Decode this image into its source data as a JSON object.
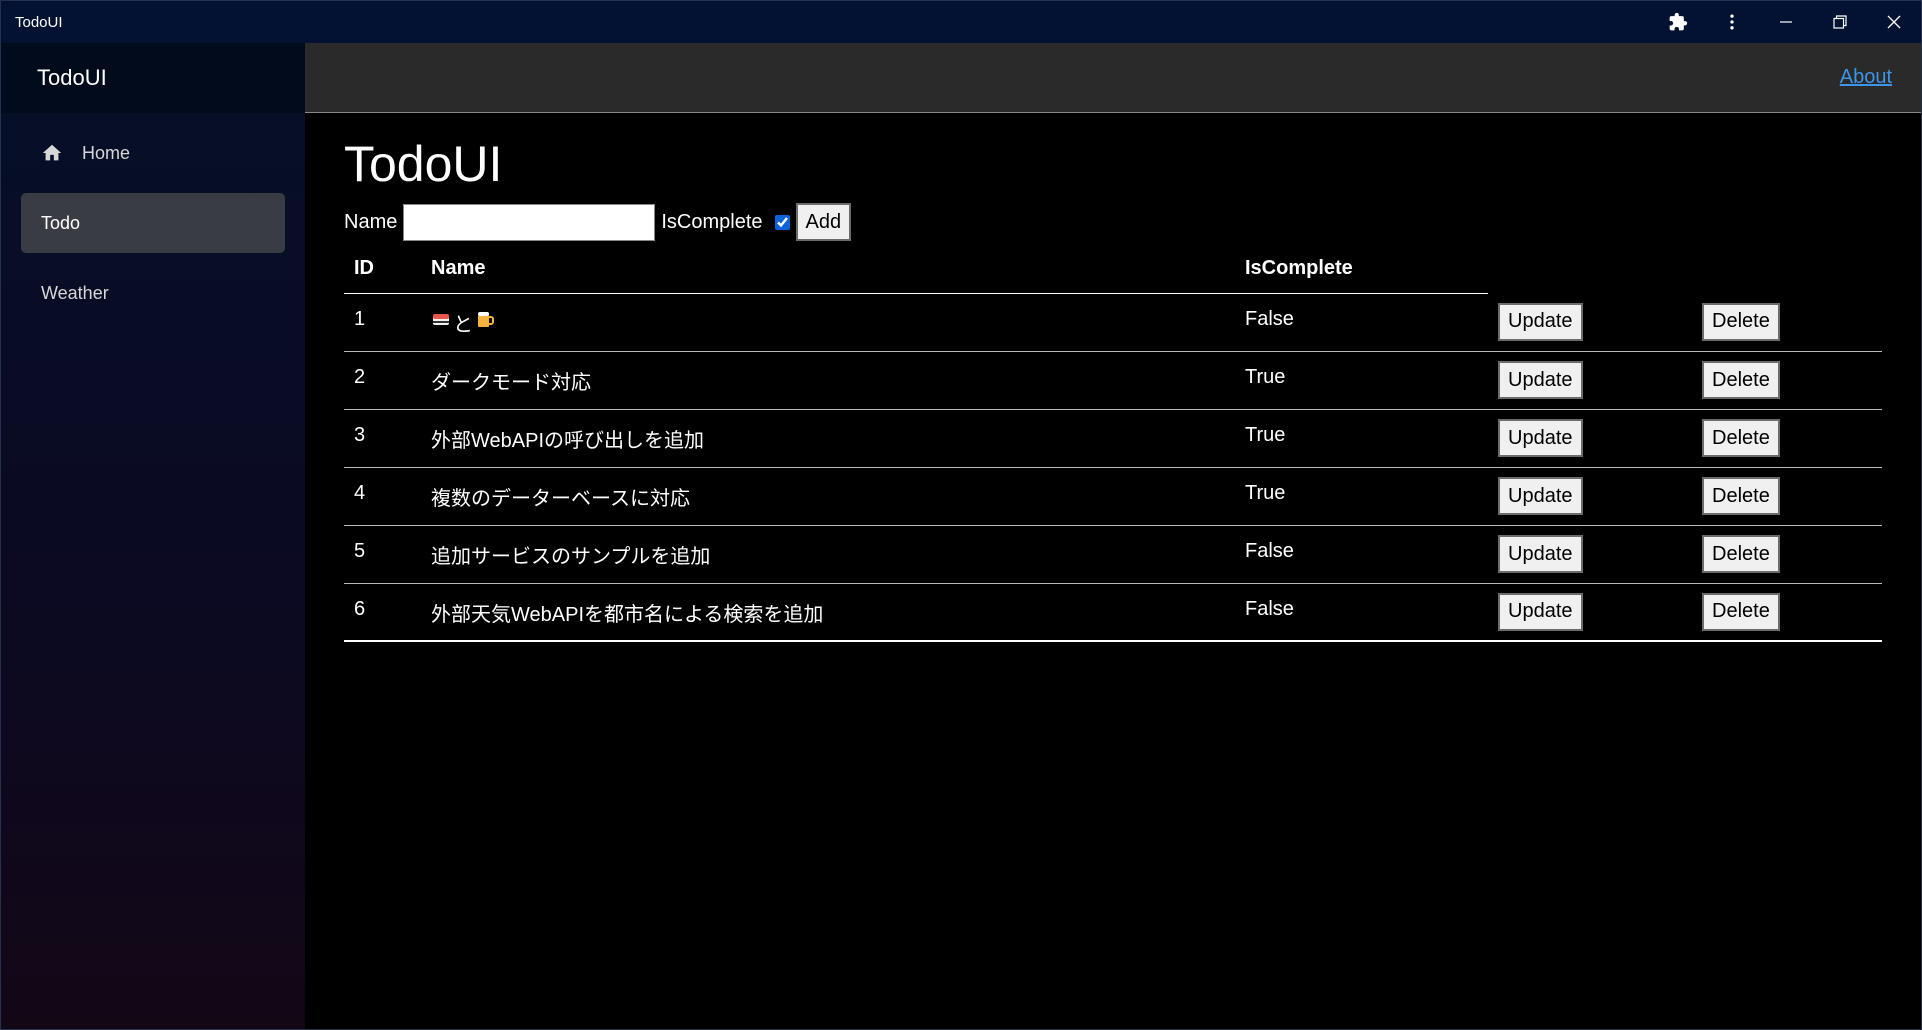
{
  "window": {
    "title": "TodoUI",
    "controls": [
      "extensions-icon",
      "more-vert-icon",
      "minimize-icon",
      "restore-icon",
      "close-icon"
    ]
  },
  "sidebar": {
    "brand": "TodoUI",
    "items": [
      {
        "label": "Home",
        "icon": "home-icon",
        "active": false
      },
      {
        "label": "Todo",
        "active": true
      },
      {
        "label": "Weather",
        "active": false
      }
    ]
  },
  "topbar": {
    "about_link": "About"
  },
  "main": {
    "title": "TodoUI",
    "form": {
      "name_label": "Name",
      "name_value": "",
      "iscomplete_label": "IsComplete",
      "iscomplete_checked": true,
      "add_label": "Add"
    },
    "table": {
      "headers": [
        "ID",
        "Name",
        "IsComplete"
      ],
      "update_label": "Update",
      "delete_label": "Delete",
      "rows": [
        {
          "id": "1",
          "name_parts": [
            "sushi-emoji",
            "と",
            "beer-emoji"
          ],
          "complete": "False"
        },
        {
          "id": "2",
          "name": "ダークモード対応",
          "complete": "True"
        },
        {
          "id": "3",
          "name": "外部WebAPIの呼び出しを追加",
          "complete": "True"
        },
        {
          "id": "4",
          "name": "複数のデーターベースに対応",
          "complete": "True"
        },
        {
          "id": "5",
          "name": "追加サービスのサンプルを追加",
          "complete": "False"
        },
        {
          "id": "6",
          "name": "外部天気WebAPIを都市名による検索を追加",
          "complete": "False"
        }
      ]
    }
  }
}
